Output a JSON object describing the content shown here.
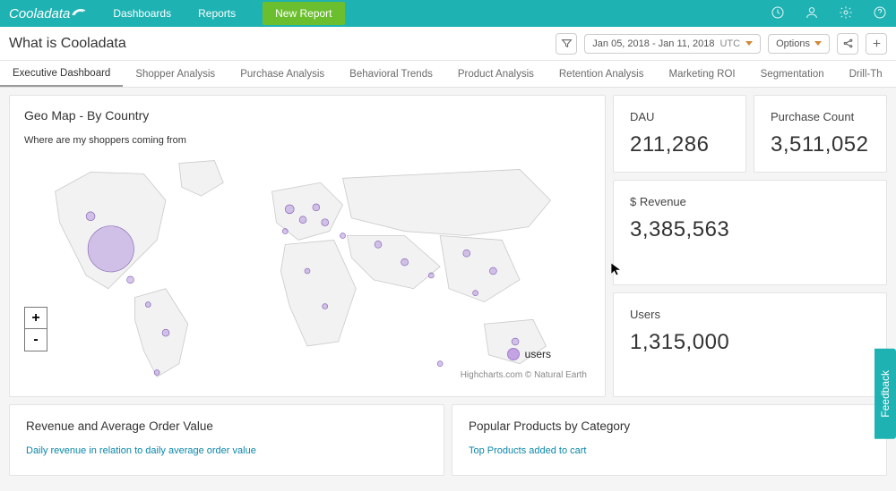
{
  "topnav": {
    "brand": "Cooladata",
    "items": [
      "Dashboards",
      "Reports"
    ],
    "new_report": "New Report"
  },
  "header": {
    "title": "What is Cooladata",
    "date_range": "Jan 05, 2018 - Jan 11, 2018",
    "tz": "UTC",
    "options": "Options"
  },
  "tabs": [
    "Executive Dashboard",
    "Shopper Analysis",
    "Purchase Analysis",
    "Behavioral Trends",
    "Product Analysis",
    "Retention Analysis",
    "Marketing ROI",
    "Segmentation",
    "Drill-Th"
  ],
  "map_panel": {
    "title": "Geo Map - By Country",
    "subtitle": "Where are my shoppers coming from",
    "legend": "users",
    "attribution": "Highcharts.com © Natural Earth"
  },
  "kpis": {
    "dau_label": "DAU",
    "dau_value": "211,286",
    "purchase_count_label": "Purchase Count",
    "purchase_count_value": "3,511,052",
    "revenue_label": "$ Revenue",
    "revenue_value": "3,385,563",
    "users_label": "Users",
    "users_value": "1,315,000"
  },
  "row2_panels": {
    "rev_title": "Revenue and Average Order Value",
    "rev_sub": "Daily revenue in relation to daily average order value",
    "pop_title": "Popular Products by Category",
    "pop_sub": "Top Products added to cart"
  },
  "feedback": "Feedback",
  "zoom": {
    "in": "+",
    "out": "-"
  }
}
